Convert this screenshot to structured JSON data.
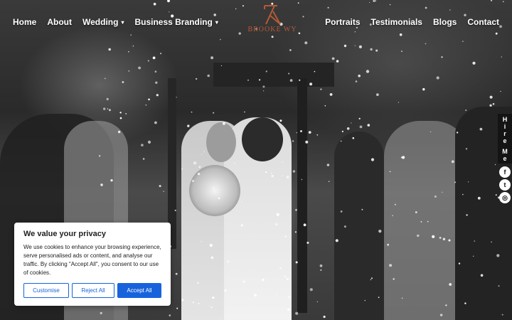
{
  "nav": {
    "left": [
      {
        "label": "Home",
        "dropdown": false
      },
      {
        "label": "About",
        "dropdown": false
      },
      {
        "label": "Wedding",
        "dropdown": true
      },
      {
        "label": "Business Branding",
        "dropdown": true
      }
    ],
    "right": [
      {
        "label": "Portraits"
      },
      {
        "label": "Testimonials"
      },
      {
        "label": "Blogs"
      },
      {
        "label": "Contact"
      }
    ]
  },
  "logo": {
    "text": "BROOKE WY"
  },
  "side": {
    "hire_letters": [
      "H",
      "i",
      "r",
      "e",
      "",
      "M",
      "e"
    ],
    "social": [
      {
        "icon": "facebook-icon",
        "glyph": "f"
      },
      {
        "icon": "twitter-icon",
        "glyph": "t"
      },
      {
        "icon": "instagram-icon",
        "glyph": "◎"
      }
    ]
  },
  "cookie": {
    "title": "We value your privacy",
    "body": "We use cookies to enhance your browsing experience, serve personalised ads or content, and analyse our traffic. By clicking \"Accept All\", you consent to our use of cookies.",
    "customise": "Customise",
    "reject": "Reject All",
    "accept": "Accept All"
  },
  "colors": {
    "accent": "#1863dc",
    "logo": "#b45a35",
    "text_dark": "#212121"
  }
}
